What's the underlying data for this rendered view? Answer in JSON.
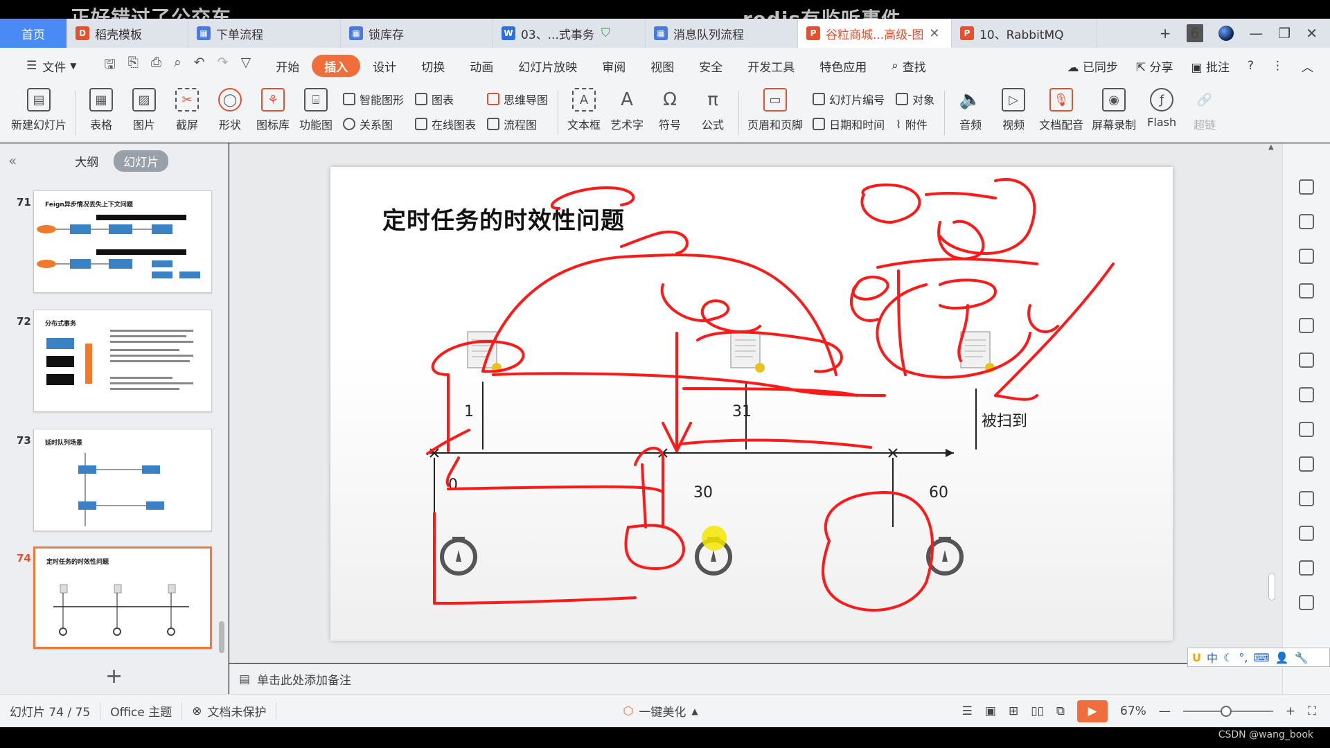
{
  "overlays": {
    "left_caption": "正好错过了公交车",
    "center_caption": "redis有监听事件"
  },
  "tabs": [
    {
      "label": "首页",
      "kind": "home"
    },
    {
      "label": "稻壳模板",
      "icon_color": "#e3512e",
      "icon_char": "D"
    },
    {
      "label": "下单流程",
      "icon_color": "#4a7ae0",
      "icon_char": "图"
    },
    {
      "label": "锁库存",
      "icon_color": "#4a7ae0",
      "icon_char": "图"
    },
    {
      "label": "03、...式事务",
      "icon_color": "#2b6fe0",
      "icon_char": "W"
    },
    {
      "label": "消息队列流程",
      "icon_color": "#4a7ae0",
      "icon_char": "图"
    },
    {
      "label": "谷粒商城...高级-图",
      "icon_color": "#e3512e",
      "icon_char": "P",
      "active": true
    },
    {
      "label": "10、RabbitMQ",
      "icon_color": "#e3512e",
      "icon_char": "P"
    }
  ],
  "tabbar_right": {
    "add": "+",
    "count": "6"
  },
  "menu": {
    "file": "文件",
    "items": [
      "开始",
      "插入",
      "设计",
      "切换",
      "动画",
      "幻灯片放映",
      "审阅",
      "视图",
      "安全",
      "开发工具",
      "特色应用"
    ],
    "active": "插入",
    "search": "查找",
    "synced": "已同步",
    "share": "分享",
    "comment": "批注",
    "help": "?"
  },
  "ribbon": {
    "new_slide": "新建幻灯片",
    "table": "表格",
    "picture": "图片",
    "screenshot": "截屏",
    "shape": "形状",
    "iconlib": "图标库",
    "funcmap": "功能图",
    "smart_shape": "智能图形",
    "chart": "图表",
    "relation": "关系图",
    "online_chart": "在线图表",
    "mindmap": "思维导图",
    "flowchart": "流程图",
    "textbox": "文本框",
    "wordart": "艺术字",
    "symbol": "符号",
    "formula": "公式",
    "header_footer": "页眉和页脚",
    "slide_number": "幻灯片编号",
    "datetime": "日期和时间",
    "object": "对象",
    "attachment": "附件",
    "audio": "音频",
    "video": "视频",
    "doc_dub": "文档配音",
    "screen_rec": "屏幕录制",
    "flash": "Flash",
    "super": "超链"
  },
  "leftpanel": {
    "outline_tab": "大纲",
    "slides_tab": "幻灯片",
    "thumbs": [
      {
        "num": "71",
        "title": "Feign异步情况丢失上下文问题"
      },
      {
        "num": "72",
        "title": "分布式事务"
      },
      {
        "num": "73",
        "title": "延时队列场景"
      },
      {
        "num": "74",
        "title": "定时任务的时效性问题",
        "active": true
      }
    ],
    "add": "+"
  },
  "slide": {
    "title": "定时任务的时效性问题",
    "labels": {
      "tick_1": "1",
      "tick_31": "31",
      "scanned": "被扫到",
      "t0": "0",
      "t30": "30",
      "t60": "60"
    }
  },
  "notes_placeholder": "单击此处添加备注",
  "status": {
    "slide_pos": "幻灯片 74 / 75",
    "theme": "Office 主题",
    "protect": "文档未保护",
    "beautify": "一键美化",
    "zoom": "67%",
    "minus": "—",
    "plus": "+"
  },
  "ime": {
    "lang": "中"
  },
  "watermark": "CSDN @wang_book",
  "colors": {
    "accent": "#f06d3c",
    "home_tab": "#4a8af4",
    "annotation_red": "#ff0000",
    "highlight_yellow": "#f5e600"
  }
}
